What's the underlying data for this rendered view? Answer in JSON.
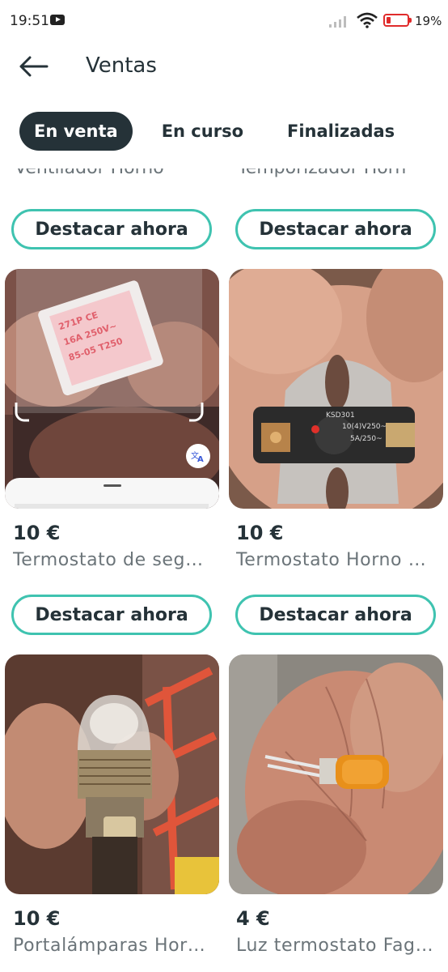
{
  "status": {
    "time": "19:51",
    "battery_pct": "19%",
    "battery_color": "#e02b2b"
  },
  "header": {
    "back_icon": "arrow-left-icon",
    "title": "Ventas"
  },
  "tabs": [
    {
      "label": "En venta",
      "active": true
    },
    {
      "label": "En curso",
      "active": false
    },
    {
      "label": "Finalizadas",
      "active": false
    }
  ],
  "colors": {
    "accent": "#3fc3b0",
    "dark": "#253238",
    "muted": "#6b7479"
  },
  "cut_off_titles": [
    "Ventilador Horno",
    "Temporizador Horn"
  ],
  "boost_label": "Destacar ahora",
  "products": [
    {
      "price": "10 €",
      "title": "Termostato de seg…",
      "image": "pink-thermostat-photo",
      "translate_icon": "translate-icon"
    },
    {
      "price": "10 €",
      "title": "Termostato Horno …",
      "image": "oven-thermostat-photo"
    },
    {
      "price": "10 €",
      "title": "Portalámparas Hor…",
      "image": "oven-lamp-holder-photo"
    },
    {
      "price": "4 €",
      "title": "Luz termostato Fag…",
      "image": "orange-indicator-light-photo"
    }
  ]
}
